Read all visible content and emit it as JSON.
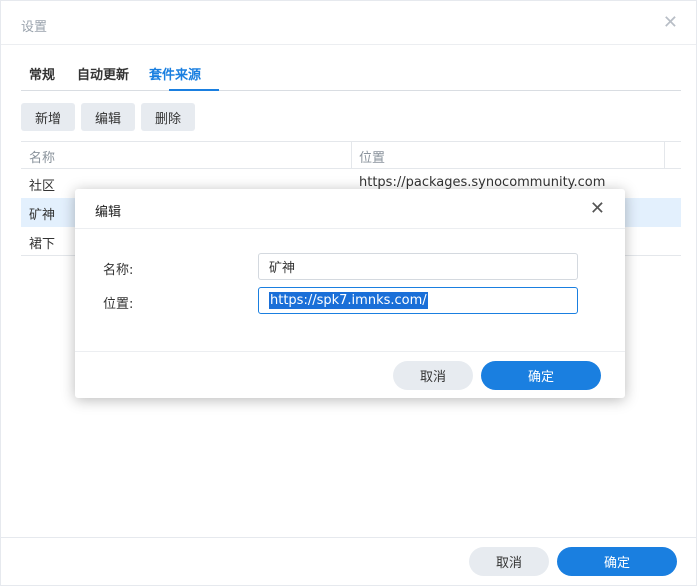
{
  "window": {
    "title": "设置"
  },
  "tabs": [
    {
      "label": "常规",
      "active": false
    },
    {
      "label": "自动更新",
      "active": false
    },
    {
      "label": "套件来源",
      "active": true
    }
  ],
  "toolbar": {
    "add_label": "新增",
    "edit_label": "编辑",
    "delete_label": "删除"
  },
  "table": {
    "columns": [
      "名称",
      "位置"
    ],
    "rows": [
      {
        "name": "社区",
        "location": "https://packages.synocommunity.com",
        "selected": false
      },
      {
        "name": "矿神",
        "location": "",
        "selected": true
      },
      {
        "name": "裙下",
        "location": "",
        "selected": false
      }
    ]
  },
  "footer": {
    "cancel_label": "取消",
    "ok_label": "确定"
  },
  "dialog": {
    "title": "编辑",
    "name_label": "名称:",
    "name_value": "矿神",
    "location_label": "位置:",
    "location_value": "https://spk7.imnks.com/",
    "cancel_label": "取消",
    "ok_label": "确定"
  },
  "colors": {
    "accent": "#1a7fe0",
    "selected_row": "#e3f0fd",
    "button_gray": "#e7ebf0"
  },
  "icons": {
    "window_close": "close-icon",
    "dialog_close": "close-icon"
  }
}
